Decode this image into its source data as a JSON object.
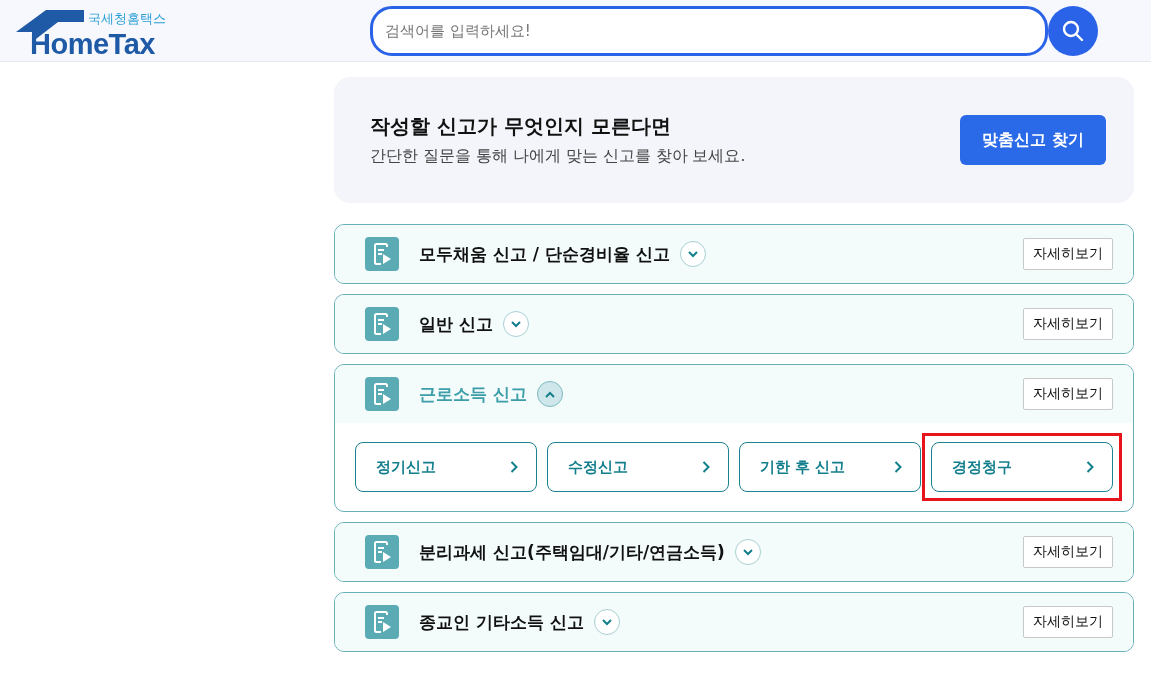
{
  "header": {
    "logo": {
      "korean": "국세청홈택스",
      "brand": "HomeTax"
    },
    "search": {
      "placeholder": "검색어를 입력하세요!"
    }
  },
  "banner": {
    "title": "작성할 신고가 무엇인지 모른다면",
    "subtitle": "간단한 질문을 통해 나에게 맞는 신고를 찾아 보세요.",
    "button": "맞춤신고 찾기"
  },
  "sections": [
    {
      "title": "모두채움 신고 / 단순경비율 신고",
      "expanded": false,
      "detail_button": "자세히보기"
    },
    {
      "title": "일반 신고",
      "expanded": false,
      "detail_button": "자세히보기"
    },
    {
      "title": "근로소득 신고",
      "expanded": true,
      "detail_button": "자세히보기",
      "items": [
        {
          "label": "정기신고",
          "highlighted": false
        },
        {
          "label": "수정신고",
          "highlighted": false
        },
        {
          "label": "기한 후 신고",
          "highlighted": false
        },
        {
          "label": "경정청구",
          "highlighted": true
        }
      ]
    },
    {
      "title": "분리과세 신고(주택임대/기타/연금소득)",
      "expanded": false,
      "detail_button": "자세히보기"
    },
    {
      "title": "종교인 기타소득 신고",
      "expanded": false,
      "detail_button": "자세히보기"
    }
  ]
}
